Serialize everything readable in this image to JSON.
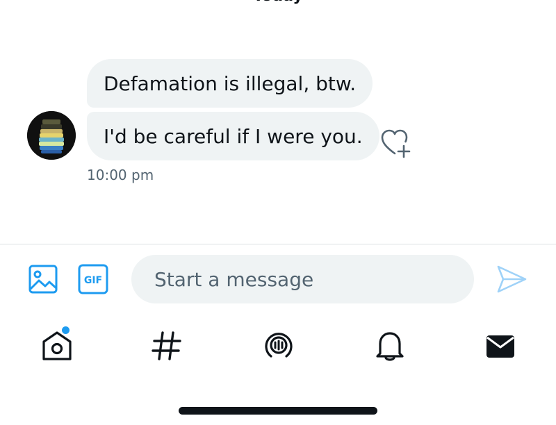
{
  "conversation": {
    "date_label": "Today",
    "messages": [
      {
        "text": "Defamation is illegal, btw."
      },
      {
        "text": "I'd be careful if I were you."
      }
    ],
    "timestamp": "10:00 pm"
  },
  "composer": {
    "placeholder": "Start a message",
    "gif_label": "GIF"
  },
  "icons": {
    "reaction": "heart-plus-icon",
    "media": "image-icon",
    "gif": "gif-icon",
    "send": "send-icon",
    "nav": [
      "home-icon",
      "hashtag-icon",
      "spaces-icon",
      "bell-icon",
      "envelope-icon"
    ]
  },
  "colors": {
    "accent": "#1d9bf0",
    "bubble": "#eff3f4",
    "muted": "#536471"
  }
}
